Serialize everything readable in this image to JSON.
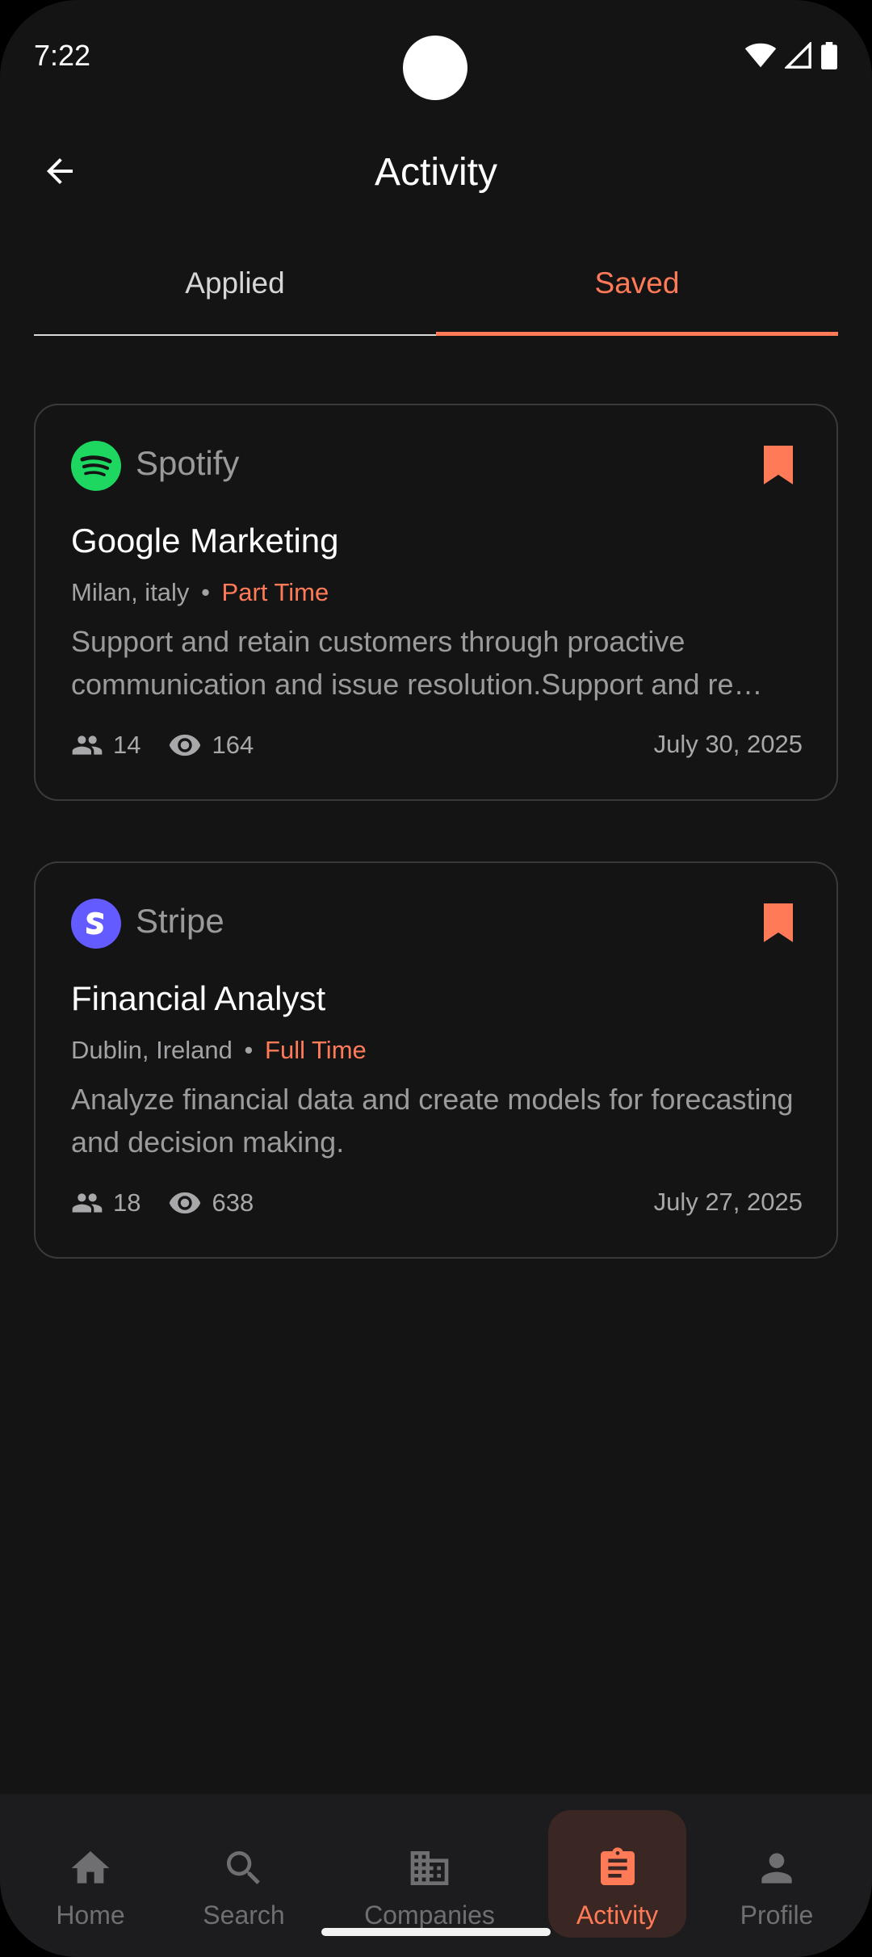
{
  "status_bar": {
    "time": "7:22"
  },
  "header": {
    "title": "Activity"
  },
  "tabs": [
    {
      "label": "Applied",
      "active": false
    },
    {
      "label": "Saved",
      "active": true
    }
  ],
  "cards": [
    {
      "company": "Spotify",
      "logo_icon": "spotify-logo-icon",
      "title": "Google Marketing",
      "location": "Milan, italy",
      "separator": "•",
      "job_type": "Part Time",
      "description": "Support and retain customers through proactive communication and issue resolution.Support and re…",
      "applicants": "14",
      "views": "164",
      "date": "July 30, 2025",
      "saved": true
    },
    {
      "company": "Stripe",
      "logo_icon": "stripe-logo-icon",
      "title": "Financial Analyst",
      "location": "Dublin, Ireland",
      "separator": "•",
      "job_type": "Full Time",
      "description": "Analyze financial data and create models for forecasting and decision making.",
      "applicants": "18",
      "views": "638",
      "date": "July 27, 2025",
      "saved": true
    }
  ],
  "bottom_nav": [
    {
      "label": "Home",
      "icon": "home-icon",
      "active": false
    },
    {
      "label": "Search",
      "icon": "search-icon",
      "active": false
    },
    {
      "label": "Companies",
      "icon": "building-icon",
      "active": false
    },
    {
      "label": "Activity",
      "icon": "clipboard-icon",
      "active": true
    },
    {
      "label": "Profile",
      "icon": "person-icon",
      "active": false
    }
  ],
  "colors": {
    "accent": "#ff7a57",
    "background": "#141415",
    "card_border": "#3a3a3c",
    "spotify_green": "#1ed760",
    "stripe_purple": "#635bff"
  }
}
